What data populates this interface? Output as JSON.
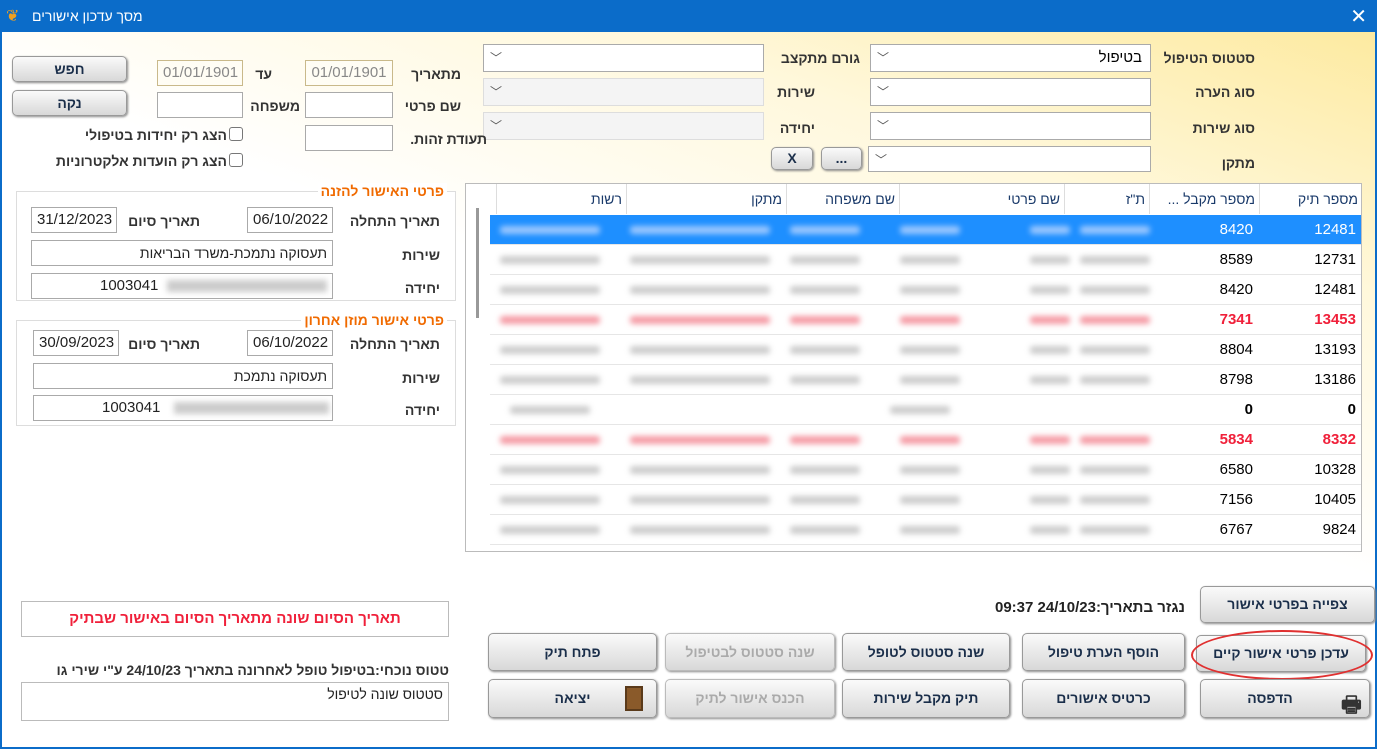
{
  "window": {
    "title": "מסך עדכון אישורים",
    "close": "✕"
  },
  "filters": {
    "status_label": "סטטוס הטיפול",
    "status_value": "בטיפול",
    "note_type_label": "סוג הערה",
    "note_type_value": "",
    "service_type_label": "סוג שירות",
    "service_type_value": "",
    "facility_label": "מתקן",
    "facility_value": "",
    "funder_label": "גורם מתקצב",
    "funder_value": "",
    "service_label": "שירות",
    "service_value": "",
    "unit_label": "יחידה",
    "unit_value": "",
    "ellipsis_button": "...",
    "clear_x_button": "X",
    "from_date_label": "מתאריך",
    "from_date_value": "01/01/1901",
    "to_date_label": "עד",
    "to_date_value": "01/01/1901",
    "first_name_label": "שם פרטי",
    "first_name_value": "",
    "last_name_label": "משפחה",
    "last_name_value": "",
    "id_label": "תעודת זהות.",
    "id_value": "",
    "search_button": "חפש",
    "clear_button": "נקה",
    "only_units_in_treatment": {
      "label": "הצג רק יחידות בטיפולי",
      "checked": false
    },
    "only_electronic": {
      "label": "הצג רק הועדות אלקטרוניות",
      "checked": false
    }
  },
  "approval_entry": {
    "title": "פרטי האישור להזנה",
    "start_label": "תאריך התחלה",
    "start_value": "06/10/2022",
    "end_label": "תאריך סיום",
    "end_value": "31/12/2023",
    "service_label": "שירות",
    "service_value": "תעסוקה נתמכת-משרד הבריאות",
    "unit_label": "יחידה",
    "unit_value": "1003041"
  },
  "last_approval": {
    "title": "פרטי אישור מוזן אחרון",
    "start_label": "תאריך התחלה",
    "start_value": "06/10/2022",
    "end_label": "תאריך סיום",
    "end_value": "30/09/2023",
    "service_label": "שירות",
    "service_value": "תעסוקה נתמכת",
    "unit_label": "יחידה",
    "unit_value": "1003041"
  },
  "table": {
    "columns": [
      "מספר תיק",
      "מספר מקבל ...",
      "ת\"ז",
      "שם פרטי",
      "שם משפחה",
      "מתקן",
      "רשות"
    ],
    "rows": [
      {
        "file": "12481",
        "recipient": "8420",
        "style": "selected"
      },
      {
        "file": "12731",
        "recipient": "8589",
        "style": "normal"
      },
      {
        "file": "12481",
        "recipient": "8420",
        "style": "normal"
      },
      {
        "file": "13453",
        "recipient": "7341",
        "style": "red"
      },
      {
        "file": "13193",
        "recipient": "8804",
        "style": "normal"
      },
      {
        "file": "13186",
        "recipient": "8798",
        "style": "normal"
      },
      {
        "file": "0",
        "recipient": "0",
        "style": "bold"
      },
      {
        "file": "8332",
        "recipient": "5834",
        "style": "red"
      },
      {
        "file": "10328",
        "recipient": "6580",
        "style": "normal"
      },
      {
        "file": "10405",
        "recipient": "7156",
        "style": "normal"
      },
      {
        "file": "9824",
        "recipient": "6767",
        "style": "normal"
      }
    ]
  },
  "messages": {
    "warning": "תאריך הסיום שונה מתאריך הסיום באישור שבתיק",
    "status_line": "טטוס נוכחי:בטיפול טופל לאחרונה בתאריך 24/10/23 ע\"י שירי גו",
    "status_note": "סטטוס שונה לטיפול",
    "derived": "נגזר בתאריך:24/10/23 09:37",
    "warning_color": "#f0203a"
  },
  "buttons": {
    "view_details": "צפייה בפרטי אישור",
    "update_existing": "עדכן פרטי אישור קיים",
    "add_note": "הוסף הערת טיפול",
    "set_handled": "שנה סטטוס לטופל",
    "set_in_treatment": "שנה סטטוס לבטיפול",
    "open_file": "פתח תיק",
    "print": "הדפסה",
    "approvals_card": "כרטיס אישורים",
    "recipient_file": "תיק מקבל שירות",
    "insert_approval": "הכנס אישור לתיק",
    "exit": "יציאה"
  }
}
